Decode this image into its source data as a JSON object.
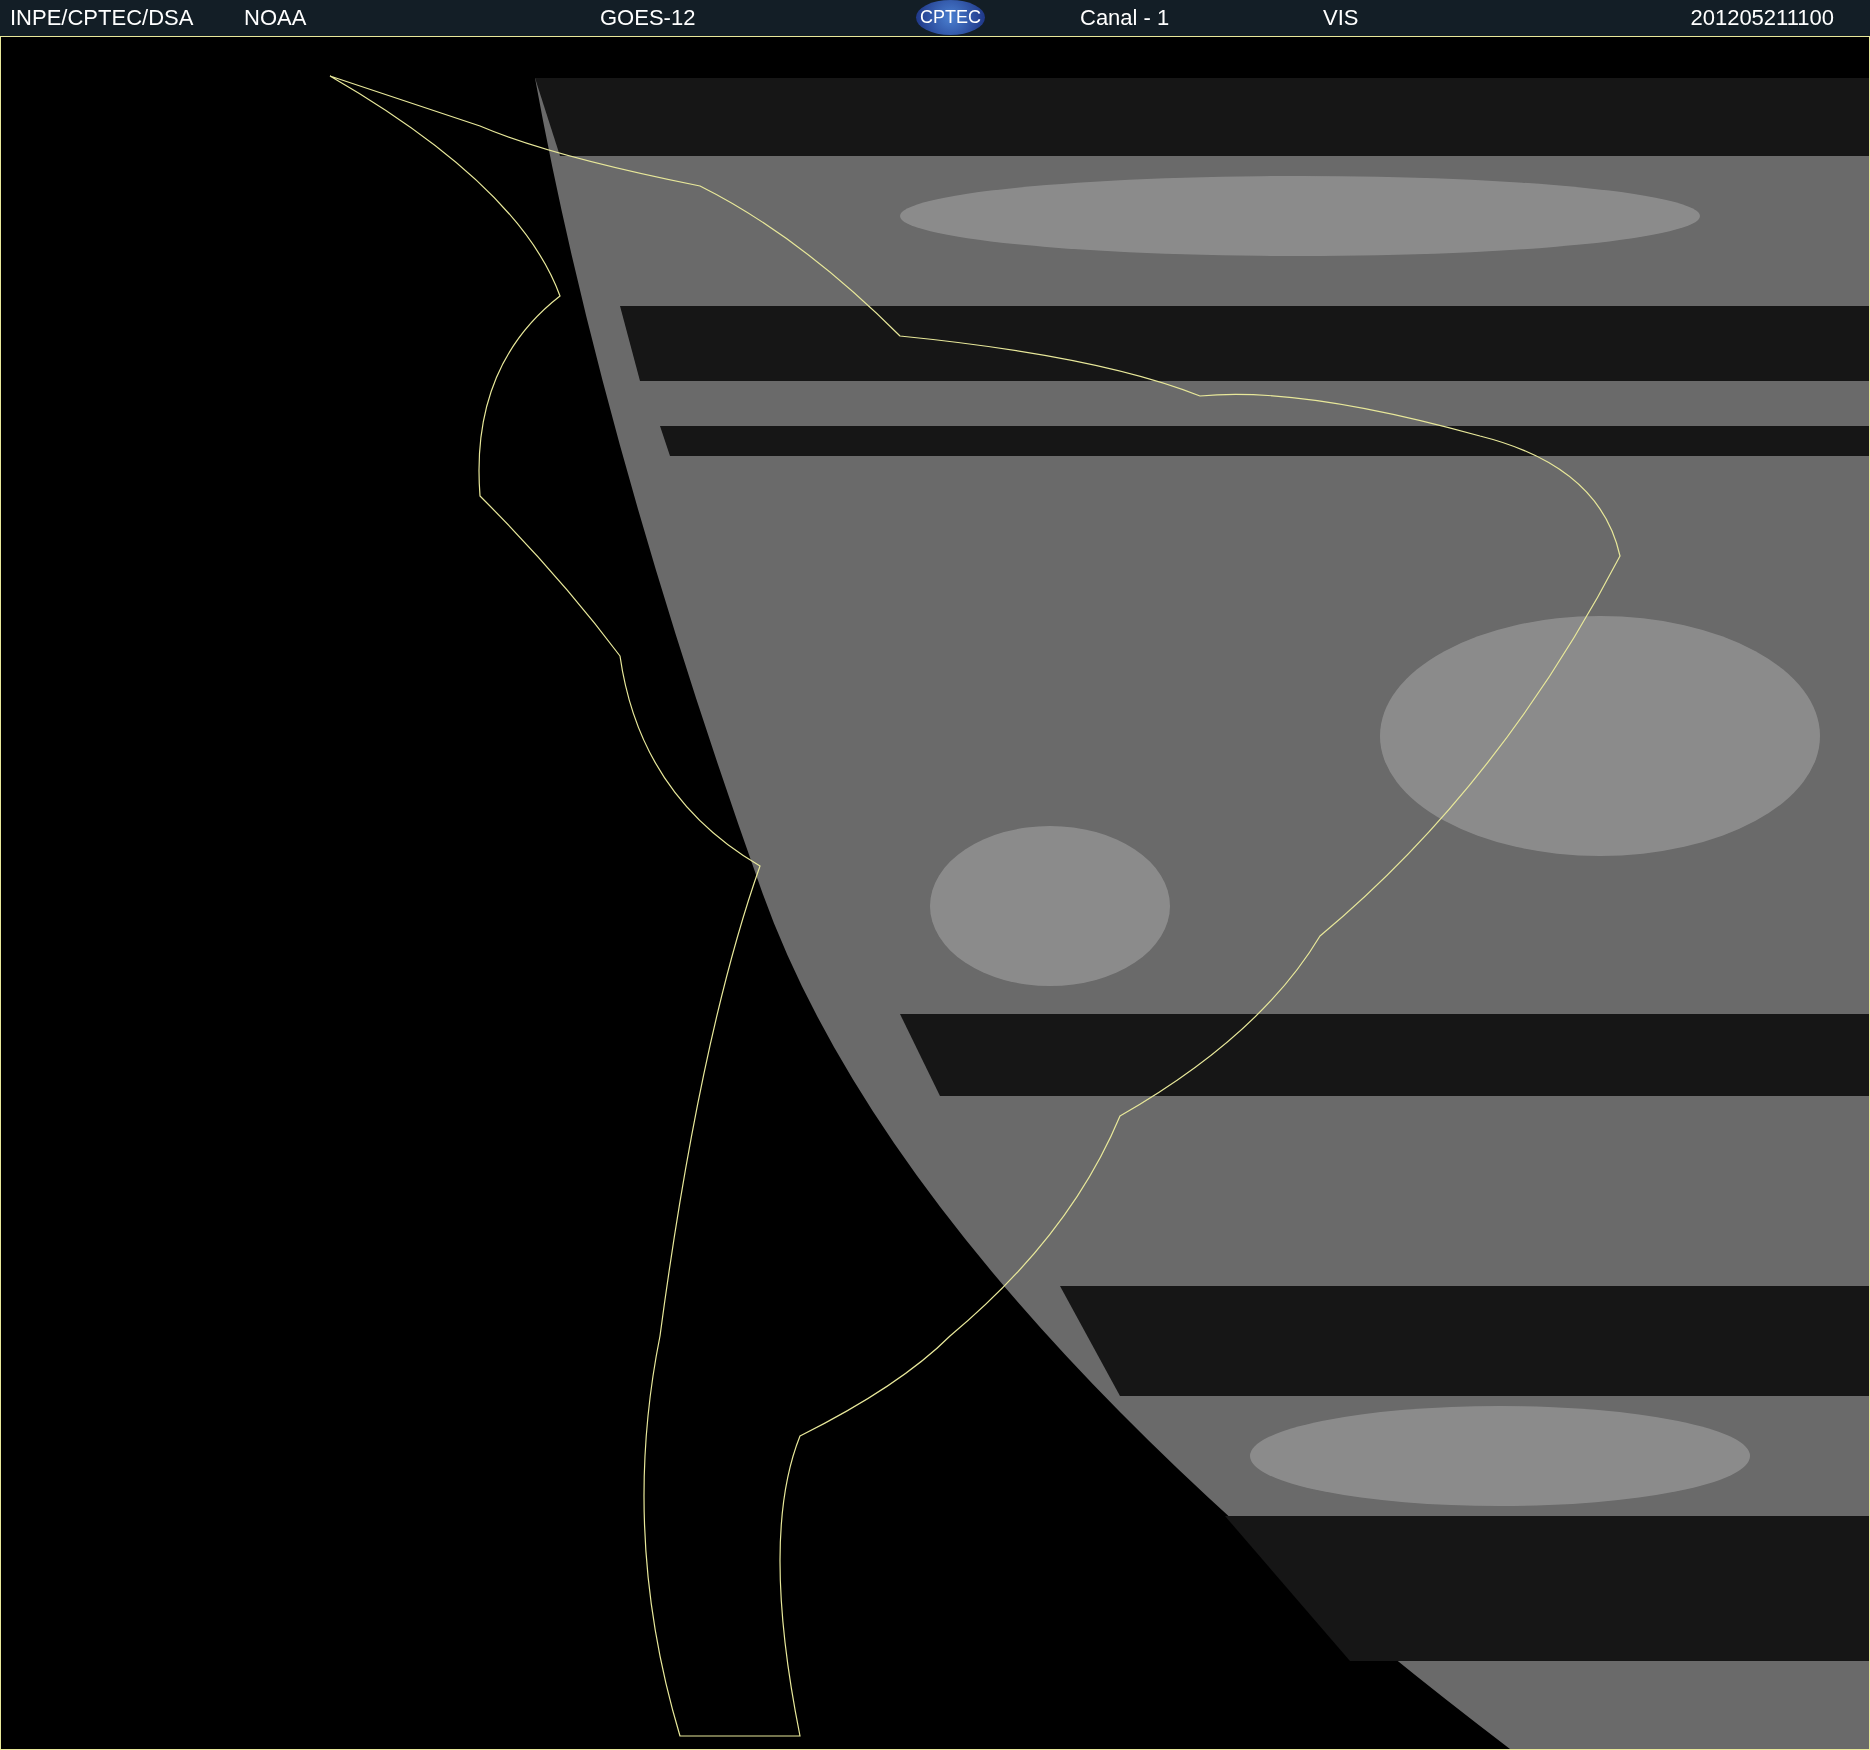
{
  "header": {
    "source": "INPE/CPTEC/DSA",
    "agency": "NOAA",
    "satellite": "GOES-12",
    "logo": "CPTEC",
    "channel": "Canal - 1",
    "band": "VIS",
    "timestamp": "201205211100"
  }
}
